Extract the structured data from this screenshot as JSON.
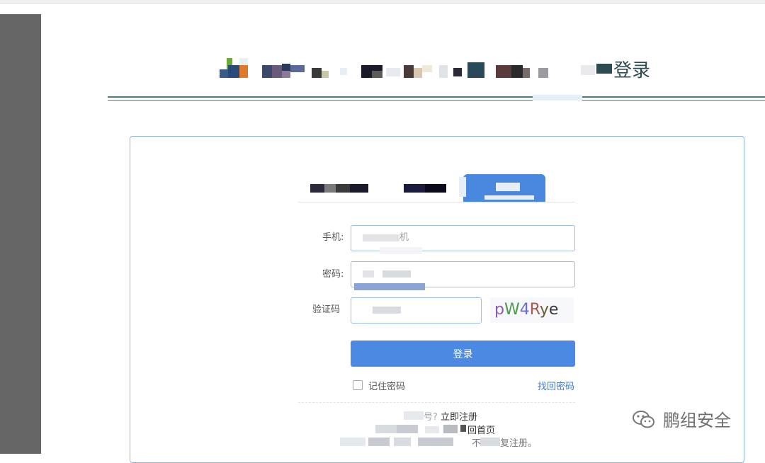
{
  "header": {
    "title_suffix": "登录"
  },
  "form": {
    "phone_label": "手机:",
    "phone_placeholder_fragment": "机",
    "password_label": "密码:",
    "captcha_label": "验证码",
    "captcha_text": "pW4Rye",
    "submit_label": "登录",
    "remember_label": "记住密码",
    "forgot_link": "找回密码"
  },
  "footer": {
    "register_question_fragment": "号?",
    "register_link": "立即注册",
    "home_link_fragment": "回首页",
    "notice_fragment_1": "不",
    "notice_fragment_2": "复注册。"
  },
  "watermark": {
    "text": "鹏组安全"
  },
  "colors": {
    "primary": "#4b89e2",
    "border": "#9dbce6",
    "header_text": "#2f4b52",
    "divider": "#4b7a7f",
    "link": "#3d78cc",
    "sidebar": "#666666"
  }
}
